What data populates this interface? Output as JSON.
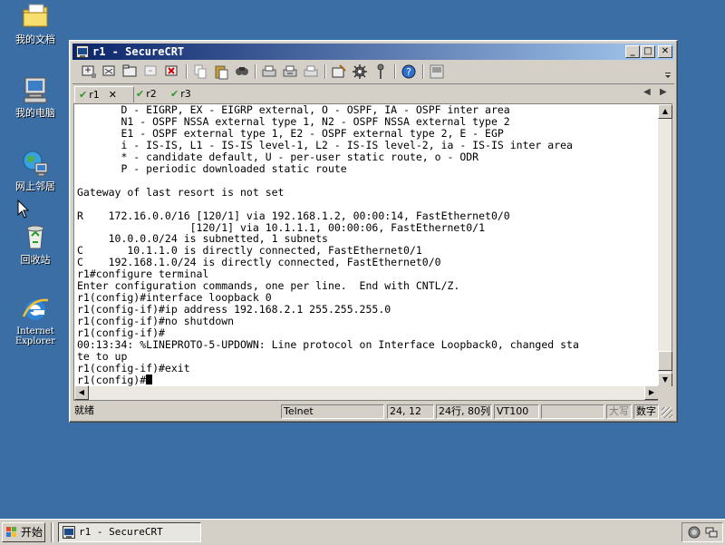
{
  "desktop": {
    "icons": [
      {
        "label": "我的文档",
        "icon": "my-documents-icon"
      },
      {
        "label": "我的电脑",
        "icon": "my-computer-icon"
      },
      {
        "label": "网上邻居",
        "icon": "network-places-icon"
      },
      {
        "label": "回收站",
        "icon": "recycle-bin-icon"
      },
      {
        "label": "Internet Explorer",
        "icon": "internet-explorer-icon"
      }
    ]
  },
  "window": {
    "title": "r1 - SecureCRT",
    "minimize_glyph": "_",
    "maximize_glyph": "□",
    "close_glyph": "✕"
  },
  "tabs": [
    {
      "label": "r1",
      "active": true,
      "close": "✕"
    },
    {
      "label": "r2",
      "active": false
    },
    {
      "label": "r3",
      "active": false
    }
  ],
  "tab_nav": {
    "prev": "◀",
    "next": "▶"
  },
  "terminal": {
    "lines": [
      "       D - EIGRP, EX - EIGRP external, O - OSPF, IA - OSPF inter area",
      "       N1 - OSPF NSSA external type 1, N2 - OSPF NSSA external type 2",
      "       E1 - OSPF external type 1, E2 - OSPF external type 2, E - EGP",
      "       i - IS-IS, L1 - IS-IS level-1, L2 - IS-IS level-2, ia - IS-IS inter area",
      "       * - candidate default, U - per-user static route, o - ODR",
      "       P - periodic downloaded static route",
      "",
      "Gateway of last resort is not set",
      "",
      "R    172.16.0.0/16 [120/1] via 192.168.1.2, 00:00:14, FastEthernet0/0",
      "                  [120/1] via 10.1.1.1, 00:00:06, FastEthernet0/1",
      "     10.0.0.0/24 is subnetted, 1 subnets",
      "C       10.1.1.0 is directly connected, FastEthernet0/1",
      "C    192.168.1.0/24 is directly connected, FastEthernet0/0",
      "r1#configure terminal",
      "Enter configuration commands, one per line.  End with CNTL/Z.",
      "r1(config)#interface loopback 0",
      "r1(config-if)#ip address 192.168.2.1 255.255.255.0",
      "r1(config-if)#no shutdown",
      "r1(config-if)#",
      "00:13:34: %LINEPROTO-5-UPDOWN: Line protocol on Interface Loopback0, changed sta",
      "te to up",
      "r1(config-if)#exit"
    ],
    "prompt": "r1(config)#"
  },
  "statusbar": {
    "ready": "就绪",
    "protocol": "Telnet",
    "cursor_pos": "24, 12",
    "dimensions": "24行, 80列",
    "emulation": "VT100",
    "caps": "大写",
    "num": "数字"
  },
  "taskbar": {
    "start_label": "开始",
    "task_title": "r1 - SecureCRT"
  },
  "colors": {
    "desktop": "#3a6ea5",
    "titlebar_start": "#0a246a",
    "titlebar_end": "#a6caf0",
    "tab_check": "#2a9a2a"
  }
}
